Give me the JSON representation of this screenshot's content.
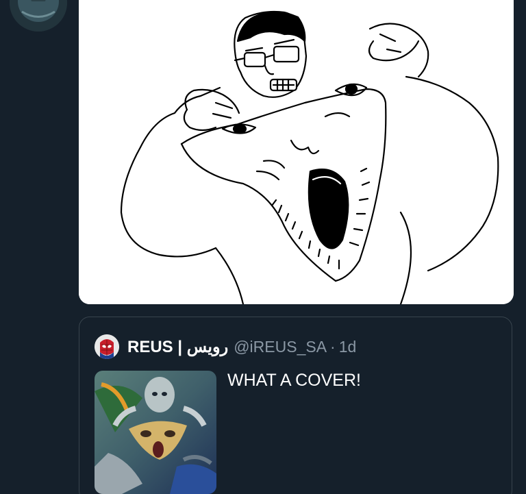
{
  "quoted_tweet": {
    "display_name": "REUS | رويس",
    "handle": "@iREUS_SA",
    "separator": "·",
    "time": "1d",
    "text": "WHAT A COVER!"
  },
  "icons": {
    "top_avatar": "profile-avatar-icon",
    "quoted_avatar": "spiderman-avatar-icon"
  },
  "colors": {
    "background": "#15202b",
    "border": "#38444d",
    "secondary_text": "#8b98a5",
    "primary_text": "#ffffff"
  }
}
